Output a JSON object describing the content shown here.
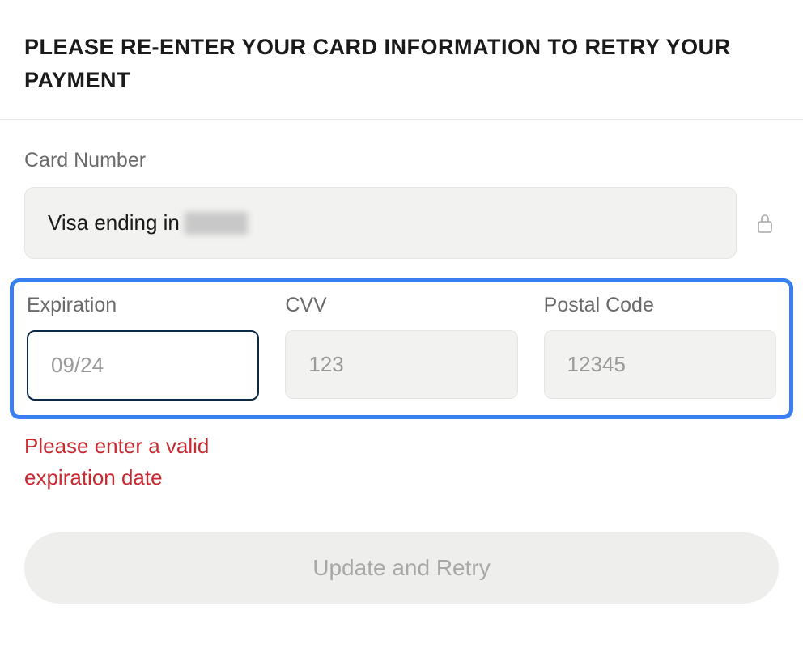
{
  "header": {
    "title": "PLEASE RE-ENTER YOUR CARD INFORMATION TO RETRY YOUR PAYMENT"
  },
  "card_number": {
    "label": "Card Number",
    "display_prefix": "Visa ending in "
  },
  "expiration": {
    "label": "Expiration",
    "placeholder": "09/24",
    "value": "",
    "error": "Please enter a valid expiration date"
  },
  "cvv": {
    "label": "CVV",
    "placeholder": "123",
    "value": ""
  },
  "postal": {
    "label": "Postal Code",
    "placeholder": "12345",
    "value": ""
  },
  "submit": {
    "label": "Update and Retry"
  }
}
